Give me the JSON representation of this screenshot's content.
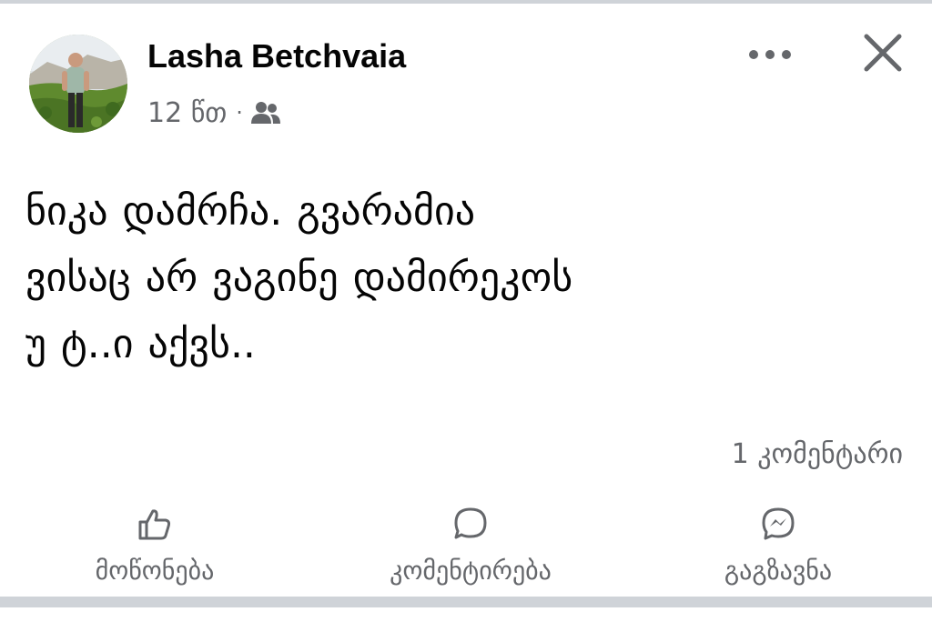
{
  "post": {
    "author_name": "Lasha Betchvaia",
    "time": "12 წთ",
    "separator": "·",
    "audience_icon": "friends-icon",
    "text": "ნიკა დამრჩა. გვარამია\nვისაც არ ვაგინე დამირეკოს\nუ ტ..ი აქვს..",
    "comment_count": "1 კომენტარი"
  },
  "header": {
    "more_icon": "more-options-icon",
    "close_icon": "close-icon"
  },
  "actions": {
    "like": {
      "label": "მოწონება",
      "icon": "thumbs-up-icon"
    },
    "comment": {
      "label": "კომენტირება",
      "icon": "comment-icon"
    },
    "share": {
      "label": "გაგზავნა",
      "icon": "messenger-icon"
    }
  },
  "colors": {
    "text_primary": "#050505",
    "text_secondary": "#65676b",
    "divider": "#cfd3d8",
    "background": "#ffffff"
  }
}
